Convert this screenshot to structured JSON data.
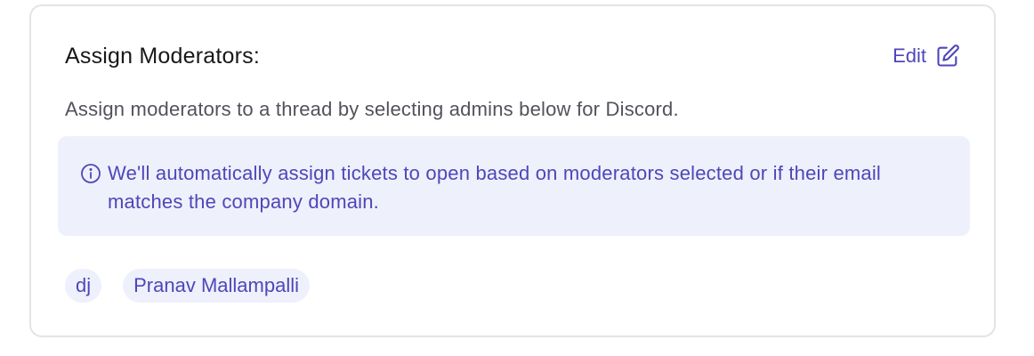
{
  "card": {
    "title": "Assign Moderators:",
    "edit_label": "Edit",
    "description": "Assign moderators to a thread by selecting admins below for Discord.",
    "info": {
      "icon": "info-circle-icon",
      "text": "We'll automatically assign tickets to open based on moderators selected or if their email matches the company domain."
    },
    "moderators": [
      {
        "label": "dj"
      },
      {
        "label": "Pranav Mallampalli"
      }
    ]
  },
  "colors": {
    "accent": "#4f46b8",
    "info_bg": "#eef0fc",
    "border": "#e4e4e7",
    "title": "#18181b",
    "muted_text": "#52525b"
  }
}
